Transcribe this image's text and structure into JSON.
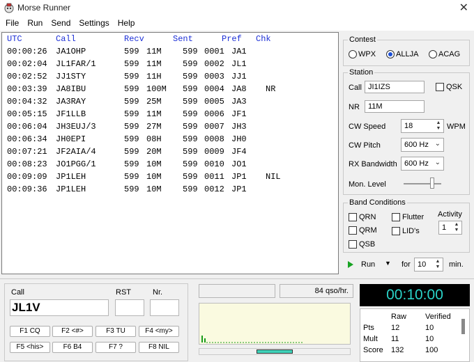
{
  "window": {
    "title": "Morse Runner",
    "close_glyph": "✕"
  },
  "menu": [
    "File",
    "Run",
    "Send",
    "Settings",
    "Help"
  ],
  "log": {
    "headers": {
      "utc": "UTC",
      "call": "Call",
      "recv": "Recv",
      "sent": "Sent",
      "pref": "Pref",
      "chk": "Chk"
    },
    "rows": [
      {
        "utc": "00:00:26",
        "call": "JA1OHP",
        "rrst": "599",
        "rnr": "11M",
        "srst": "599",
        "snr": "0001",
        "pref": "JA1",
        "chk": ""
      },
      {
        "utc": "00:02:04",
        "call": "JL1FAR/1",
        "rrst": "599",
        "rnr": "11M",
        "srst": "599",
        "snr": "0002",
        "pref": "JL1",
        "chk": ""
      },
      {
        "utc": "00:02:52",
        "call": "JJ1STY",
        "rrst": "599",
        "rnr": "11H",
        "srst": "599",
        "snr": "0003",
        "pref": "JJ1",
        "chk": ""
      },
      {
        "utc": "00:03:39",
        "call": "JA8IBU",
        "rrst": "599",
        "rnr": "100M",
        "srst": "599",
        "snr": "0004",
        "pref": "JA8",
        "chk": "NR"
      },
      {
        "utc": "00:04:32",
        "call": "JA3RAY",
        "rrst": "599",
        "rnr": "25M",
        "srst": "599",
        "snr": "0005",
        "pref": "JA3",
        "chk": ""
      },
      {
        "utc": "00:05:15",
        "call": "JF1LLB",
        "rrst": "599",
        "rnr": "11M",
        "srst": "599",
        "snr": "0006",
        "pref": "JF1",
        "chk": ""
      },
      {
        "utc": "00:06:04",
        "call": "JH3EUJ/3",
        "rrst": "599",
        "rnr": "27M",
        "srst": "599",
        "snr": "0007",
        "pref": "JH3",
        "chk": ""
      },
      {
        "utc": "00:06:34",
        "call": "JH0EPI",
        "rrst": "599",
        "rnr": "08H",
        "srst": "599",
        "snr": "0008",
        "pref": "JH0",
        "chk": ""
      },
      {
        "utc": "00:07:21",
        "call": "JF2AIA/4",
        "rrst": "599",
        "rnr": "20M",
        "srst": "599",
        "snr": "0009",
        "pref": "JF4",
        "chk": ""
      },
      {
        "utc": "00:08:23",
        "call": "JO1PGG/1",
        "rrst": "599",
        "rnr": "10M",
        "srst": "599",
        "snr": "0010",
        "pref": "JO1",
        "chk": ""
      },
      {
        "utc": "00:09:09",
        "call": "JP1LEH",
        "rrst": "599",
        "rnr": "10M",
        "srst": "599",
        "snr": "0011",
        "pref": "JP1",
        "chk": "NIL"
      },
      {
        "utc": "00:09:36",
        "call": "JP1LEH",
        "rrst": "599",
        "rnr": "10M",
        "srst": "599",
        "snr": "0012",
        "pref": "JP1",
        "chk": ""
      }
    ]
  },
  "contest": {
    "title": "Contest",
    "options": [
      "WPX",
      "ALLJA",
      "ACAG"
    ],
    "selected": "ALLJA"
  },
  "station": {
    "title": "Station",
    "call_label": "Call",
    "call_value": "JI1IZS",
    "qsk_label": "QSK",
    "nr_label": "NR",
    "nr_value": "11M",
    "cw_speed_label": "CW Speed",
    "cw_speed_value": "18",
    "wpm_label": "WPM",
    "cw_pitch_label": "CW Pitch",
    "cw_pitch_value": "600 Hz",
    "rx_bw_label": "RX Bandwidth",
    "rx_bw_value": "600 Hz",
    "mon_level_label": "Mon. Level"
  },
  "band": {
    "title": "Band Conditions",
    "qrn": "QRN",
    "flutter": "Flutter",
    "qrm": "QRM",
    "lids": "LID's",
    "qsb": "QSB",
    "activity_label": "Activity",
    "activity_value": "1"
  },
  "run": {
    "label": "Run",
    "for_label": "for",
    "minutes": "10",
    "min_label": "min."
  },
  "entry": {
    "call_label": "Call",
    "rst_label": "RST",
    "nr_label": "Nr.",
    "call_value": "JL1V"
  },
  "fkeys": [
    "F1 CQ",
    "F2 <#>",
    "F3 TU",
    "F4 <my>",
    "F5 <his>",
    "F6 B4",
    "F7 ?",
    "F8 NIL"
  ],
  "rate": "84 qso/hr.",
  "timer": "00:10:00",
  "score": {
    "headers": {
      "raw": "Raw",
      "verified": "Verified"
    },
    "rows": [
      {
        "label": "Pts",
        "raw": "12",
        "verified": "10"
      },
      {
        "label": "Mult",
        "raw": "11",
        "verified": "10"
      },
      {
        "label": "Score",
        "raw": "132",
        "verified": "100"
      }
    ]
  },
  "colors": {
    "header_blue": "#1c2fd6",
    "timer_text": "#2ad3c8",
    "run_green": "#17a322"
  }
}
